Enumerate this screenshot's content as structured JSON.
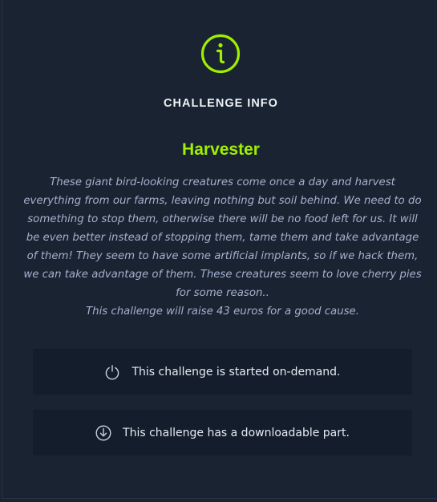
{
  "header": {
    "icon": "info-circle-icon",
    "title": "CHALLENGE INFO"
  },
  "challenge": {
    "name": "Harvester",
    "description": "These giant bird-looking creatures come once a day and harvest everything from our farms, leaving nothing but soil behind. We need to do something to stop them, otherwise there will be no food left for us. It will be even better instead of stopping them, tame them and take advantage of them! They seem to have some artificial implants, so if we hack them, we can take advantage of them. These creatures seem to love cherry pies for some reason..",
    "charity_note": "This challenge will raise 43 euros for a good cause."
  },
  "info_boxes": [
    {
      "icon": "power-icon",
      "text": "This challenge is started on-demand."
    },
    {
      "icon": "download-icon",
      "text": "This challenge has a downloadable part."
    }
  ],
  "colors": {
    "background": "#1a2332",
    "box_background": "#141d2b",
    "accent": "#9fef00",
    "description_text": "#a4b1cd"
  }
}
